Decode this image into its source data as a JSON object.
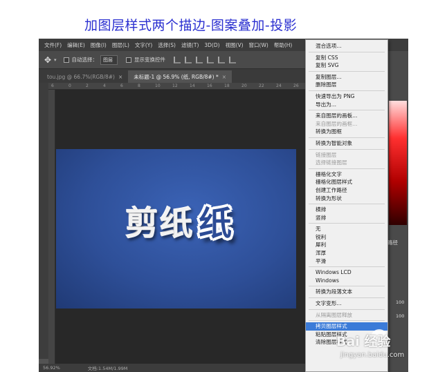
{
  "caption": "加图层样式两个描边-图案叠加-投影",
  "menubar": [
    "文件(F)",
    "编辑(E)",
    "图像(I)",
    "图层(L)",
    "文字(Y)",
    "选择(S)",
    "滤镜(T)",
    "3D(D)",
    "视图(V)",
    "窗口(W)",
    "帮助(H)"
  ],
  "options": {
    "auto_select_label": "自动选择：",
    "auto_select_value": "图层",
    "show_transform_label": "显示变换控件"
  },
  "tabs": [
    {
      "label": "tou.jpg @ 66.7%(RGB/8#)",
      "close": "×",
      "active": false
    },
    {
      "label": "未标题-1 @ 56.9% (纸, RGB/8#) *",
      "close": "×",
      "active": true
    }
  ],
  "ruler_top": [
    "6",
    "0",
    "2",
    "4",
    "6",
    "8",
    "10",
    "12",
    "14",
    "16",
    "18",
    "20",
    "22",
    "24",
    "26"
  ],
  "canvas_text": [
    "剪",
    "纸",
    "纸"
  ],
  "status": {
    "zoom": "56.92%",
    "doc": "文档:1.54M/1.99M"
  },
  "right_panel": {
    "label": "路径",
    "rows": [
      "100",
      "100"
    ]
  },
  "context_menu": [
    {
      "label": "混合选项...",
      "state": "normal"
    },
    {
      "sep": true
    },
    {
      "label": "复制 CSS",
      "state": "normal"
    },
    {
      "label": "复制 SVG",
      "state": "normal"
    },
    {
      "sep": true
    },
    {
      "label": "复制图层...",
      "state": "normal"
    },
    {
      "label": "删除图层",
      "state": "normal"
    },
    {
      "sep": true
    },
    {
      "label": "快速导出为 PNG",
      "state": "normal"
    },
    {
      "label": "导出为...",
      "state": "normal"
    },
    {
      "sep": true
    },
    {
      "label": "来自图层的画板...",
      "state": "normal"
    },
    {
      "label": "来自图层的画框...",
      "state": "disabled"
    },
    {
      "label": "转换为图框",
      "state": "normal"
    },
    {
      "sep": true
    },
    {
      "label": "转换为智能对象",
      "state": "normal"
    },
    {
      "sep": true
    },
    {
      "label": "链接图层",
      "state": "disabled"
    },
    {
      "label": "选择链接图层",
      "state": "disabled"
    },
    {
      "sep": true
    },
    {
      "label": "栅格化文字",
      "state": "normal"
    },
    {
      "label": "栅格化图层样式",
      "state": "normal"
    },
    {
      "label": "创建工作路径",
      "state": "normal"
    },
    {
      "label": "转换为形状",
      "state": "normal"
    },
    {
      "sep": true
    },
    {
      "label": "横排",
      "state": "normal"
    },
    {
      "label": "竖排",
      "state": "normal"
    },
    {
      "sep": true
    },
    {
      "label": "无",
      "state": "normal"
    },
    {
      "label": "锐利",
      "state": "normal"
    },
    {
      "label": "犀利",
      "state": "normal"
    },
    {
      "label": "浑厚",
      "state": "normal"
    },
    {
      "label": "平滑",
      "state": "normal"
    },
    {
      "sep": true
    },
    {
      "label": "Windows LCD",
      "state": "normal"
    },
    {
      "label": "Windows",
      "state": "normal"
    },
    {
      "sep": true
    },
    {
      "label": "转换为段落文本",
      "state": "normal"
    },
    {
      "sep": true
    },
    {
      "label": "文字变形...",
      "state": "normal"
    },
    {
      "sep": true
    },
    {
      "label": "从隔离图层释放",
      "state": "disabled"
    },
    {
      "sep": true
    },
    {
      "label": "拷贝图层样式",
      "state": "highlighted"
    },
    {
      "label": "粘贴图层样式",
      "state": "normal"
    },
    {
      "label": "清除图层样式",
      "state": "normal"
    }
  ],
  "watermark": {
    "logo": "Bai 经验",
    "url": "jingyan.baidu.com"
  }
}
